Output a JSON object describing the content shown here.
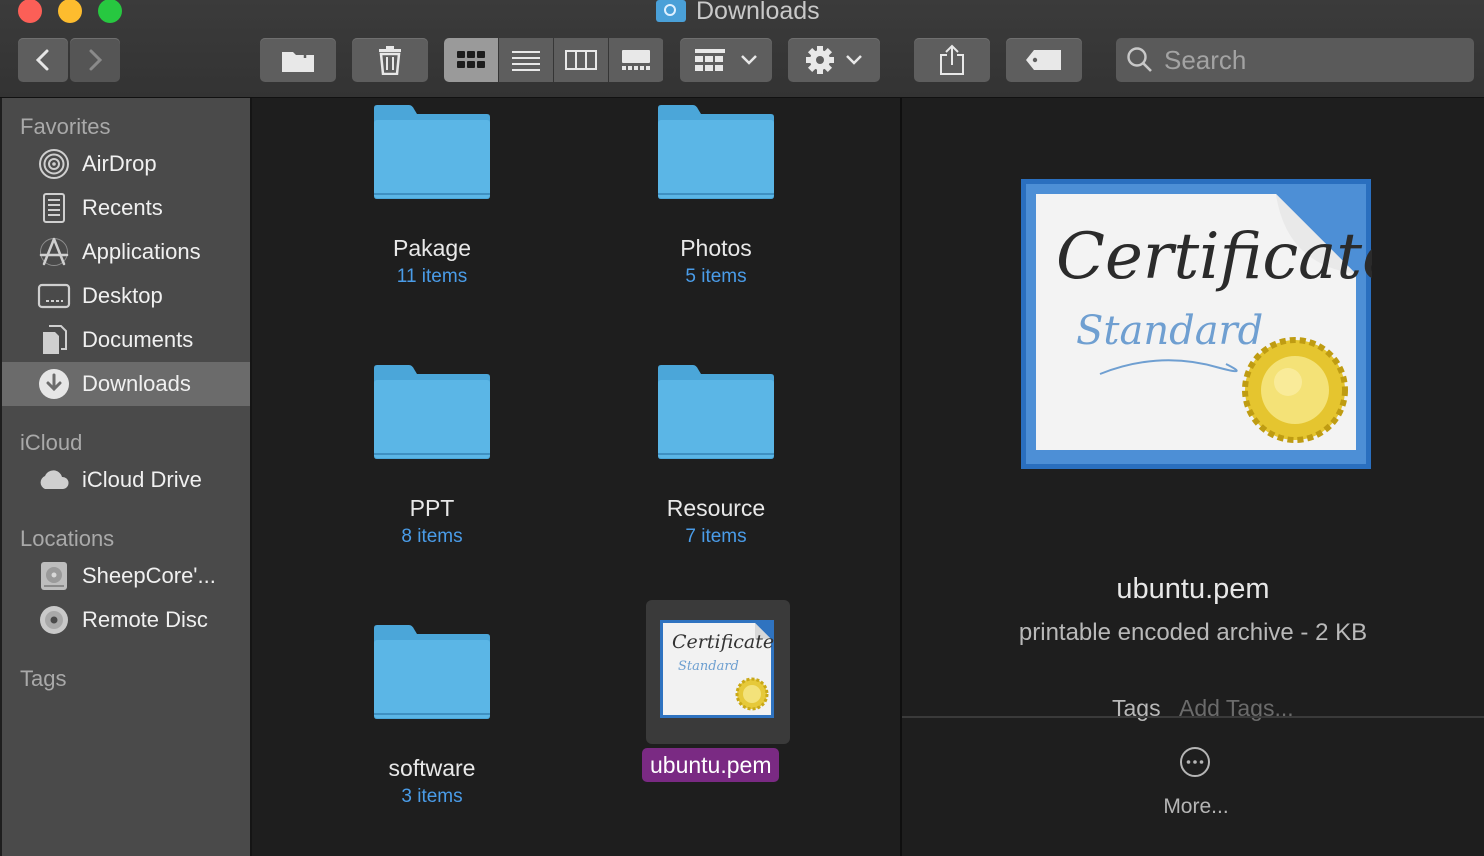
{
  "window": {
    "title": "Downloads"
  },
  "toolbar": {
    "search_placeholder": "Search"
  },
  "sidebar": {
    "favorites_header": "Favorites",
    "favorites": [
      {
        "label": "AirDrop",
        "icon": "airdrop-icon"
      },
      {
        "label": "Recents",
        "icon": "recents-icon"
      },
      {
        "label": "Applications",
        "icon": "applications-icon"
      },
      {
        "label": "Desktop",
        "icon": "desktop-icon"
      },
      {
        "label": "Documents",
        "icon": "documents-icon"
      },
      {
        "label": "Downloads",
        "icon": "downloads-icon",
        "selected": true
      }
    ],
    "icloud_header": "iCloud",
    "icloud": [
      {
        "label": "iCloud Drive",
        "icon": "cloud-icon"
      }
    ],
    "locations_header": "Locations",
    "locations": [
      {
        "label": "SheepCore'...",
        "icon": "hard-disk-icon"
      },
      {
        "label": "Remote Disc",
        "icon": "optical-disc-icon"
      }
    ],
    "tags_header": "Tags"
  },
  "files": [
    {
      "name": "Pakage",
      "count": "11 items",
      "kind": "folder"
    },
    {
      "name": "Photos",
      "count": "5 items",
      "kind": "folder"
    },
    {
      "name": "PPT",
      "count": "8 items",
      "kind": "folder"
    },
    {
      "name": "Resource",
      "count": "7 items",
      "kind": "folder"
    },
    {
      "name": "software",
      "count": "3 items",
      "kind": "folder"
    },
    {
      "name": "ubuntu.pem",
      "kind": "certificate",
      "selected": true
    }
  ],
  "preview": {
    "cert_title": "Certificate",
    "cert_subtitle": "Standard",
    "filename": "ubuntu.pem",
    "kind": "printable encoded archive - 2 KB",
    "tags_label": "Tags",
    "tags_placeholder": "Add Tags...",
    "more_label": "More..."
  },
  "colors": {
    "selection_label": "#7a2a83",
    "item_count": "#4a9ce8",
    "folder": "#5bb6e6"
  }
}
